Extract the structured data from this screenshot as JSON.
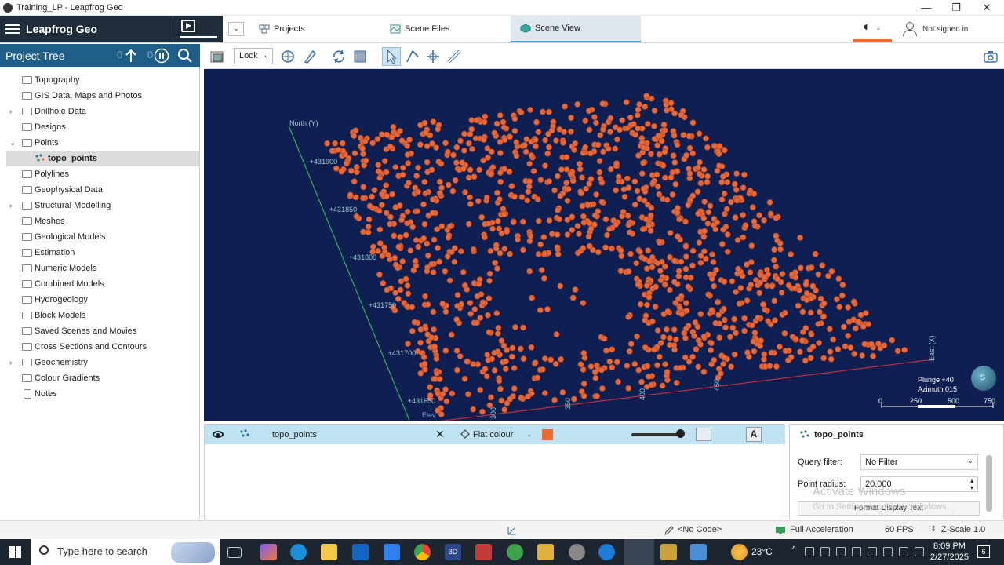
{
  "window": {
    "title": "Training_LP - Leapfrog Geo",
    "controls": [
      "—",
      "❐",
      "✕"
    ]
  },
  "header": {
    "brand": "Leapfrog Geo",
    "tabs": [
      {
        "label": "Projects",
        "icon": "projects-icon"
      },
      {
        "label": "Scene Files",
        "icon": "scene-files-icon"
      },
      {
        "label": "Scene View",
        "icon": "scene-view-icon",
        "active": true
      }
    ],
    "user": "Not signed in",
    "accent": "#ef6b2e"
  },
  "project_tree": {
    "title": "Project Tree",
    "counter_left": "0",
    "counter_right": "0",
    "items": [
      {
        "label": "Topography",
        "expander": ""
      },
      {
        "label": "GIS Data, Maps and Photos",
        "expander": ""
      },
      {
        "label": "Drillhole Data",
        "expander": "›"
      },
      {
        "label": "Designs",
        "expander": ""
      },
      {
        "label": "Points",
        "expander": "⌄"
      },
      {
        "label": "topo_points",
        "expander": "",
        "selected": true
      },
      {
        "label": "Polylines",
        "expander": ""
      },
      {
        "label": "Geophysical Data",
        "expander": ""
      },
      {
        "label": "Structural Modelling",
        "expander": "›"
      },
      {
        "label": "Meshes",
        "expander": ""
      },
      {
        "label": "Geological Models",
        "expander": ""
      },
      {
        "label": "Estimation",
        "expander": ""
      },
      {
        "label": "Numeric Models",
        "expander": ""
      },
      {
        "label": "Combined Models",
        "expander": ""
      },
      {
        "label": "Hydrogeology",
        "expander": ""
      },
      {
        "label": "Block Models",
        "expander": ""
      },
      {
        "label": "Saved Scenes and Movies",
        "expander": ""
      },
      {
        "label": "Cross Sections and Contours",
        "expander": ""
      },
      {
        "label": "Geochemistry",
        "expander": "›"
      },
      {
        "label": "Colour Gradients",
        "expander": ""
      },
      {
        "label": "Notes",
        "expander": "",
        "doc": true
      }
    ]
  },
  "viewport_toolbar": {
    "look_label": "Look"
  },
  "scene": {
    "background": "#0f1f52",
    "point_color": "#e8683a",
    "north_label": "North (Y)",
    "east_label": "East (X)",
    "elev_label": "Elev",
    "north_ticks": [
      "+431900",
      "+431850",
      "+431800",
      "+431750",
      "+431700",
      "+431650"
    ],
    "east_ticks": [
      "300",
      "350",
      "400",
      "450"
    ],
    "plunge": "Plunge +40",
    "azimuth": "Azimuth 015",
    "scale_ticks": [
      "0",
      "250",
      "500",
      "750"
    ],
    "compass_label": "S"
  },
  "shape_list": {
    "name": "topo_points",
    "mode": "Flat colour",
    "swatch_color": "#ef6b2e",
    "text_btn": "A"
  },
  "properties": {
    "title": "topo_points",
    "query_filter_label": "Query filter:",
    "query_filter_value": "No Filter",
    "point_radius_label": "Point radius:",
    "point_radius_value": "20.000",
    "format_button": "Format Display Text",
    "watermark_1": "Activate Windows",
    "watermark_2": "Go to Settings to activate Windows."
  },
  "status_bar": {
    "code": "<No Code>",
    "acceleration": "Full Acceleration",
    "fps": "60 FPS",
    "zscale": "Z-Scale 1.0"
  },
  "taskbar": {
    "search_placeholder": "Type here to search",
    "temperature": "23°C",
    "time": "8:09 PM",
    "date": "2/27/2025",
    "notifications": "6"
  }
}
